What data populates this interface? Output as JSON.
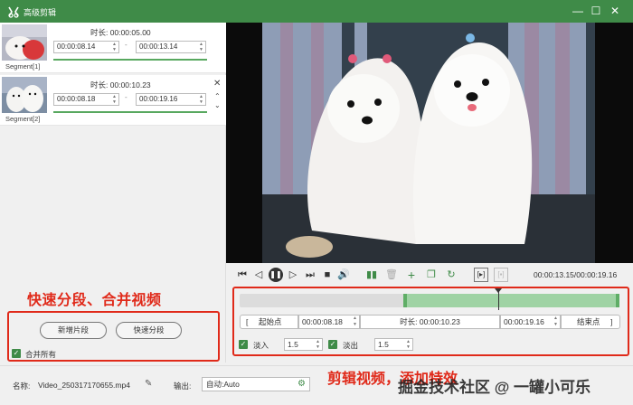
{
  "window": {
    "title": "高级剪辑",
    "minimize_icon": "minimize-icon",
    "maximize_icon": "maximize-icon",
    "close_icon": "close-icon"
  },
  "segments": [
    {
      "name": "Segment[1]",
      "duration_label": "时长:",
      "duration": "00:00:05.00",
      "start": "00:00:08.14",
      "end": "00:00:13.14",
      "separator": "-"
    },
    {
      "name": "Segment[2]",
      "duration_label": "时长:",
      "duration": "00:00:10.23",
      "start": "00:00:08.18",
      "end": "00:00:19.16",
      "separator": "-"
    }
  ],
  "left_panel": {
    "annotation": "快速分段、合并视频",
    "new_segment_label": "新增片段",
    "quick_split_label": "快速分段",
    "merge_all_label": "合并所有",
    "merge_all_checked": true
  },
  "player": {
    "timecode": "00:00:13.15/00:00:19.16"
  },
  "edit": {
    "start_btn_label": "起始点",
    "start_bracket": "[",
    "start_value": "00:00:08.18",
    "duration_label": "时长:",
    "duration_value": "00:00:10.23",
    "end_value": "00:00:19.16",
    "end_btn_label": "结束点",
    "end_bracket": "]",
    "fade_in_label": "淡入",
    "fade_in_value": "1.5",
    "fade_out_label": "淡出",
    "fade_out_value": "1.5",
    "timeline_selection_start": 0.43,
    "timeline_selection_end": 1.0,
    "playhead_position": 0.68
  },
  "bottom": {
    "name_label": "名称:",
    "filename": "Video_250317170655.mp4",
    "output_label": "输出:",
    "output_value": "自动:Auto",
    "annotation": "剪辑视频，添加特效",
    "watermark": "掘金技术社区 @ 一罐小可乐"
  },
  "colors": {
    "accent": "#3f8b48",
    "annotation_red": "#e02a1a",
    "timeline_selection": "#9fd3a4"
  }
}
